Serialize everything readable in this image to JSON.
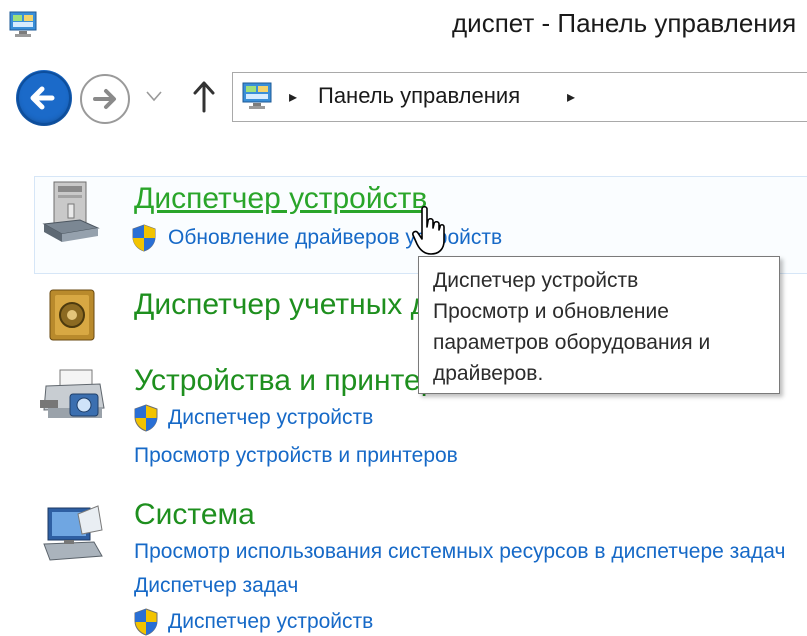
{
  "window": {
    "title": "диспет - Панель управления",
    "icon": "control-panel-icon"
  },
  "nav": {
    "back_icon": "back-arrow-icon",
    "forward_icon": "forward-arrow-icon",
    "recent_icon": "chevron-down-icon",
    "up_icon": "up-arrow-icon",
    "address": {
      "icon": "control-panel-icon",
      "separator": "▸",
      "breadcrumb": "Панель управления"
    }
  },
  "results": [
    {
      "title": "Диспетчер устройств",
      "icon": "device-manager-icon",
      "hovered": true,
      "links": [
        {
          "text": "Обновление драйверов устройств",
          "shield": true
        }
      ]
    },
    {
      "title": "Диспетчер учетных данных",
      "icon": "credential-vault-icon",
      "links": []
    },
    {
      "title": "Устройства и принтеры",
      "icon": "devices-printers-icon",
      "links": [
        {
          "text": "Диспетчер устройств",
          "shield": true
        },
        {
          "text": "Просмотр устройств и принтеров",
          "shield": false
        }
      ]
    },
    {
      "title": "Система",
      "icon": "system-icon",
      "links": [
        {
          "text": "Просмотр использования системных ресурсов в диспетчере задач",
          "shield": false
        },
        {
          "text": "Диспетчер задач",
          "shield": false
        },
        {
          "text": "Диспетчер устройств",
          "shield": true
        }
      ]
    }
  ],
  "tooltip": {
    "title": "Диспетчер устройств",
    "lines": [
      "Просмотр и обновление",
      "параметров оборудования и",
      "драйверов."
    ]
  },
  "colors": {
    "title_green": "#1e8f1e",
    "link_blue": "#1669c7",
    "back_button": "#1b6ac9"
  }
}
